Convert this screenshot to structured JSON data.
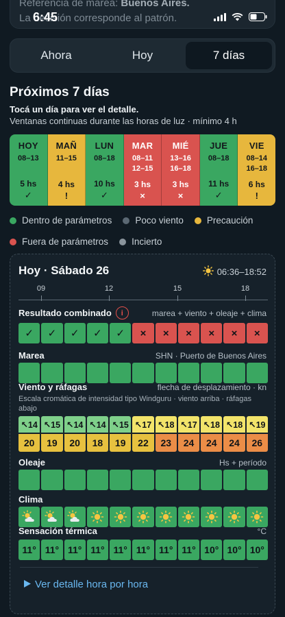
{
  "notice": {
    "prefix": "Referencia de marea:",
    "place": "Buenos Aires.",
    "line2": "La decisión corresponde al patrón."
  },
  "status": {
    "time": "6:45"
  },
  "tabs": [
    {
      "label": "Ahora"
    },
    {
      "label": "Hoy"
    },
    {
      "label": "7 días",
      "active": true
    }
  ],
  "week": {
    "title": "Próximos 7 días",
    "hint": "Tocá un día para ver el detalle.",
    "note": "Ventanas continuas durante las horas de luz · mínimo 4 h",
    "days": [
      {
        "name": "HOY",
        "range": "08–13",
        "range2": "",
        "hours": "5 hs",
        "mark": "✓",
        "status": "g"
      },
      {
        "name": "MAÑ",
        "range": "11–15",
        "range2": "",
        "hours": "4 hs",
        "mark": "!",
        "status": "y"
      },
      {
        "name": "LUN",
        "range": "08–18",
        "range2": "",
        "hours": "10 hs",
        "mark": "✓",
        "status": "g"
      },
      {
        "name": "MAR",
        "range": "08–11",
        "range2": "12–15",
        "hours": "3 hs",
        "mark": "×",
        "status": "r"
      },
      {
        "name": "MIÉ",
        "range": "13–16",
        "range2": "16–18",
        "hours": "3 hs",
        "mark": "×",
        "status": "r"
      },
      {
        "name": "JUE",
        "range": "08–18",
        "range2": "",
        "hours": "11 hs",
        "mark": "✓",
        "status": "g"
      },
      {
        "name": "VIE",
        "range": "08–14",
        "range2": "16–18",
        "hours": "6 hs",
        "mark": "!",
        "status": "y"
      }
    ]
  },
  "legend": {
    "in": "Dentro de parámetros",
    "low": "Poco viento",
    "warn": "Precaución",
    "out": "Fuera de parámetros",
    "unk": "Incierto",
    "colors": {
      "in": "#3aa761",
      "low": "#5b6873",
      "warn": "#e7b73d",
      "out": "#d9534f",
      "unk": "#8a949c"
    }
  },
  "today": {
    "title": "Hoy · Sábado 26",
    "sun": "06:36–18:52",
    "ticks": [
      "09",
      "12",
      "15",
      "18"
    ],
    "combined": {
      "label": "Resultado combinado",
      "info_icon": "i",
      "meta": "marea + viento + oleaje + clima",
      "cells": [
        {
          "mark": "✓",
          "c": "cg"
        },
        {
          "mark": "✓",
          "c": "cg"
        },
        {
          "mark": "✓",
          "c": "cg"
        },
        {
          "mark": "✓",
          "c": "cg"
        },
        {
          "mark": "✓",
          "c": "cg"
        },
        {
          "mark": "×",
          "c": "cr"
        },
        {
          "mark": "×",
          "c": "cr"
        },
        {
          "mark": "×",
          "c": "cr"
        },
        {
          "mark": "×",
          "c": "cr"
        },
        {
          "mark": "×",
          "c": "cr"
        },
        {
          "mark": "×",
          "c": "cr"
        }
      ]
    },
    "tide": {
      "label": "Marea",
      "meta": "SHN · Puerto de Buenos Aires"
    },
    "wind": {
      "label": "Viento y ráfagas",
      "meta": "flecha de desplazamiento · kn",
      "note": "Escala cromática de intensidad tipo Windguru · viento arriba · ráfagas abajo",
      "speed": [
        {
          "v": "↖14",
          "c": "cgl"
        },
        {
          "v": "↖15",
          "c": "cgl"
        },
        {
          "v": "↖14",
          "c": "cgl"
        },
        {
          "v": "↖14",
          "c": "cgl"
        },
        {
          "v": "↖15",
          "c": "cgl"
        },
        {
          "v": "↖17",
          "c": "cyl"
        },
        {
          "v": "↖18",
          "c": "cyl"
        },
        {
          "v": "↖17",
          "c": "cyl"
        },
        {
          "v": "↖18",
          "c": "cyl"
        },
        {
          "v": "↖18",
          "c": "cyl"
        },
        {
          "v": "↖19",
          "c": "cyl"
        }
      ],
      "gust": [
        {
          "v": "20",
          "c": "cy"
        },
        {
          "v": "19",
          "c": "cy"
        },
        {
          "v": "20",
          "c": "cy"
        },
        {
          "v": "18",
          "c": "cy"
        },
        {
          "v": "19",
          "c": "cy"
        },
        {
          "v": "22",
          "c": "cy"
        },
        {
          "v": "23",
          "c": "co"
        },
        {
          "v": "24",
          "c": "co"
        },
        {
          "v": "24",
          "c": "co"
        },
        {
          "v": "24",
          "c": "co"
        },
        {
          "v": "26",
          "c": "co"
        }
      ]
    },
    "waves": {
      "label": "Oleaje",
      "meta": "Hs + período"
    },
    "weather": {
      "label": "Clima",
      "icons": [
        "partly-cloudy",
        "partly-cloudy",
        "partly-cloudy",
        "sun",
        "sun",
        "sun",
        "sun",
        "sun",
        "sun",
        "sun",
        "sun"
      ]
    },
    "feels": {
      "label": "Sensación térmica",
      "unit": "°C",
      "values": [
        "11°",
        "11°",
        "11°",
        "11°",
        "11°",
        "11°",
        "11°",
        "11°",
        "10°",
        "10°",
        "10°"
      ]
    },
    "link": "Ver detalle hora por hora"
  }
}
